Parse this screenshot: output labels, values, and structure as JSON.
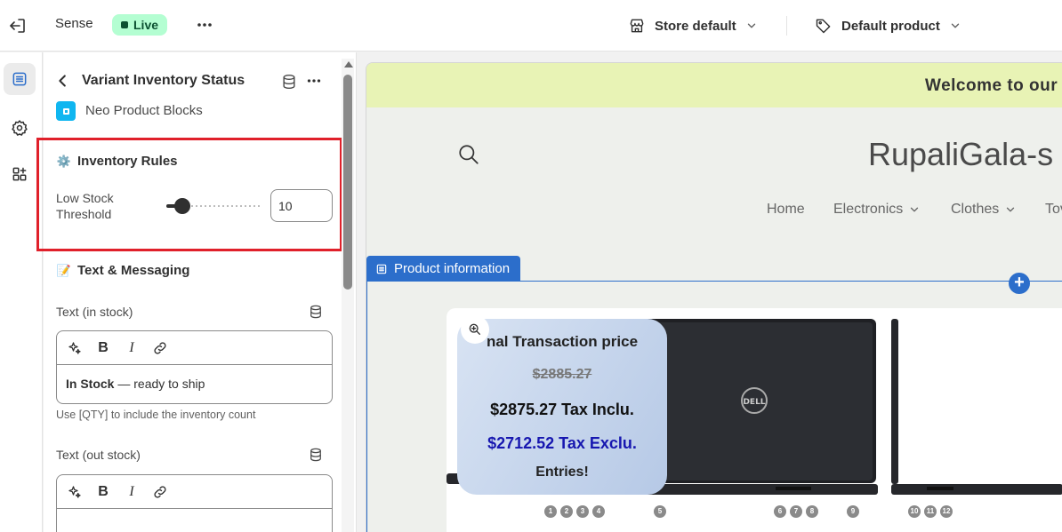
{
  "topbar": {
    "theme_name": "Sense",
    "live_label": "Live",
    "store_selector": "Store default",
    "product_selector": "Default product"
  },
  "panel": {
    "block_title": "Variant Inventory Status",
    "app_name": "Neo Product Blocks",
    "inventory_rules": {
      "title": "Inventory Rules",
      "emoji": "⚙️",
      "low_stock_label": "Low Stock Threshold",
      "low_stock_value": "10",
      "slider_fraction": 0.1
    },
    "text_messaging": {
      "title": "Text & Messaging",
      "emoji": "📝",
      "in_stock_label": "Text (in stock)",
      "in_stock_bold": "In Stock",
      "in_stock_rest": " — ready to ship",
      "in_stock_help": "Use [QTY] to include the inventory count",
      "out_stock_label": "Text (out stock)"
    },
    "toolbar": {
      "bold": "B",
      "italic": "I"
    }
  },
  "preview": {
    "announcement": "Welcome to our",
    "store_logo": "RupaliGala-s",
    "nav": [
      {
        "label": "Home",
        "dropdown": false
      },
      {
        "label": "Electronics",
        "dropdown": true
      },
      {
        "label": "Clothes",
        "dropdown": true
      },
      {
        "label": "Tov",
        "dropdown": false
      }
    ],
    "section_tab": "Product information",
    "overlay": {
      "title": "nal Transaction price",
      "strike_price": "$2885.27",
      "incl_price": "$2875.27 Tax Inclu.",
      "excl_price": "$2712.52 Tax Exclu.",
      "entries": "Entries!"
    },
    "callouts_left": [
      "1",
      "2",
      "3",
      "4"
    ],
    "callouts_mid1": [
      "5"
    ],
    "callouts_mid2": [
      "6",
      "7",
      "8"
    ],
    "callouts_mid3": [
      "9"
    ],
    "callouts_right": [
      "10",
      "11",
      "12"
    ]
  },
  "colors": {
    "accent": "#2c6ecb",
    "live_bg": "#b4fed2",
    "highlight": "#e0202a",
    "announce_bg": "#e8f3b5"
  }
}
